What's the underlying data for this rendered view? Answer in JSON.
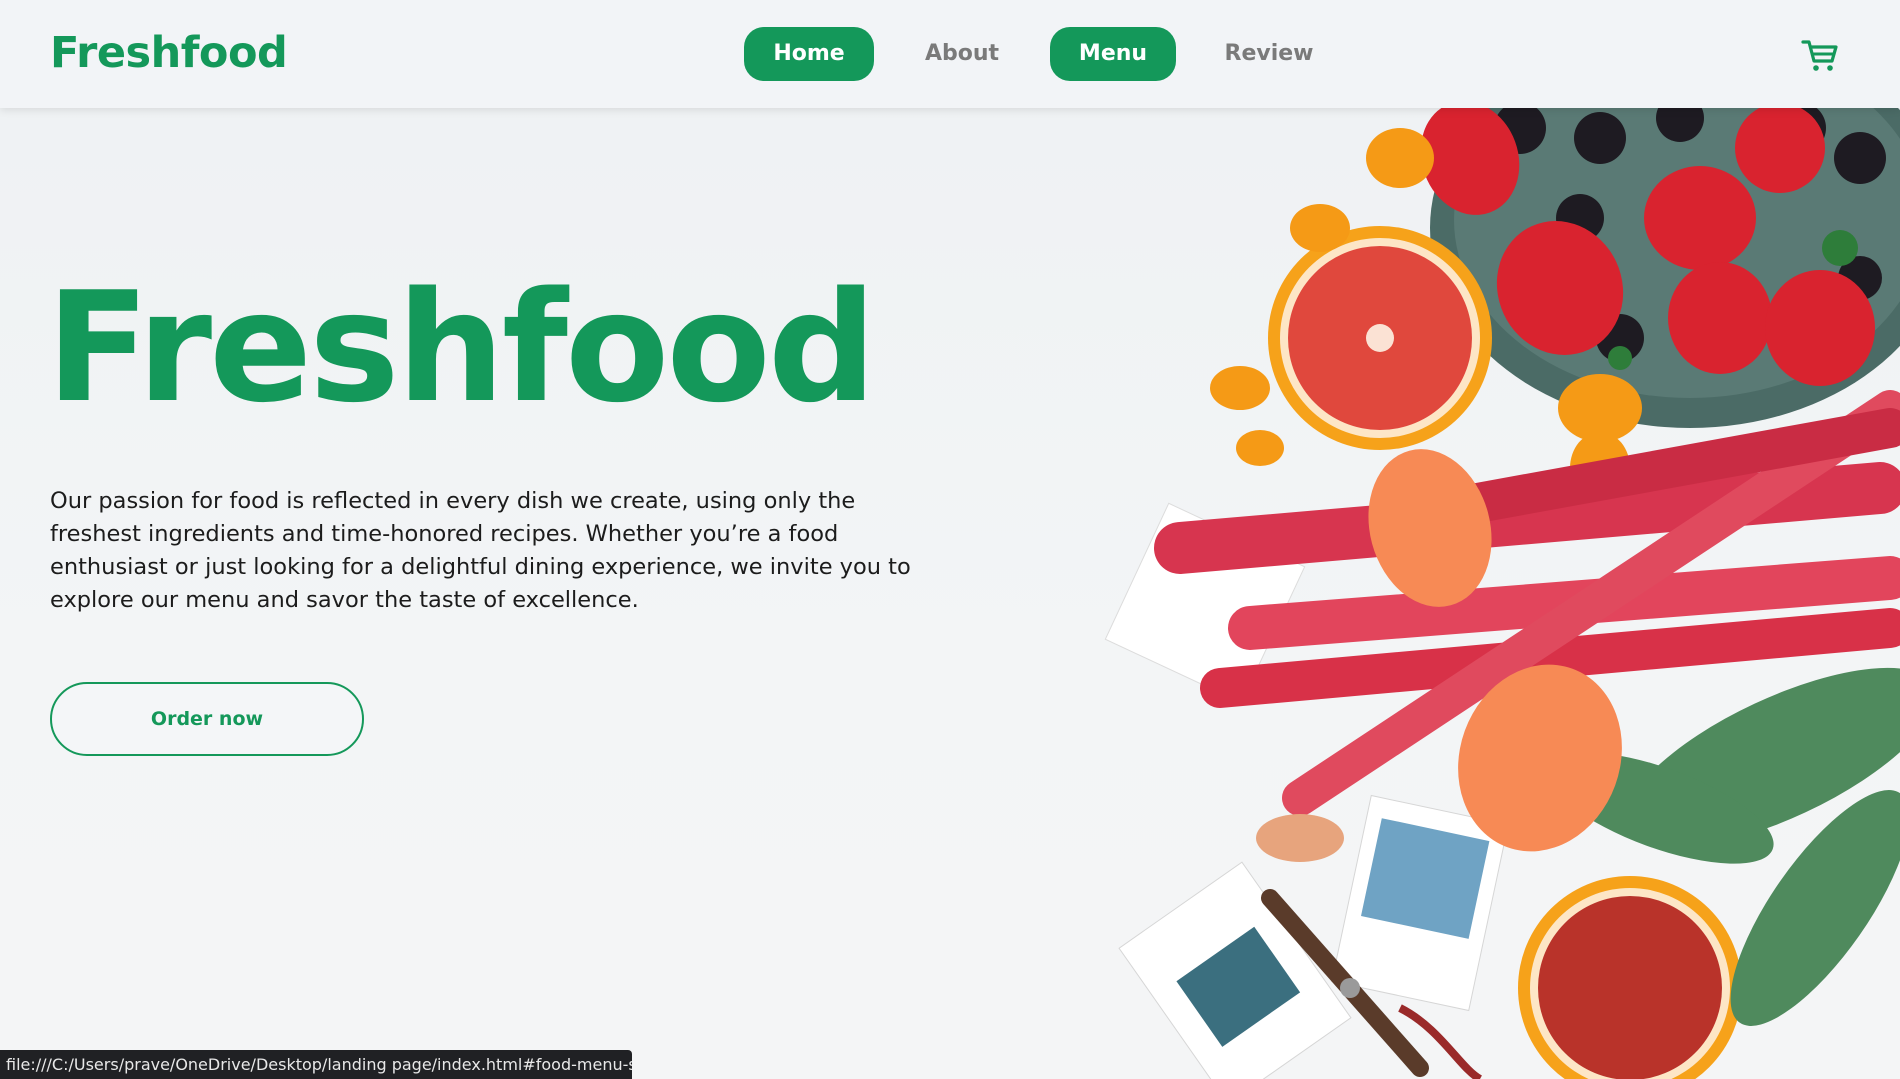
{
  "navbar": {
    "logo": "Freshfood",
    "links": [
      {
        "label": "Home",
        "active": true
      },
      {
        "label": "About",
        "active": false
      },
      {
        "label": "Menu",
        "active": true
      },
      {
        "label": "Review",
        "active": false
      }
    ],
    "cart_icon": "shopping-cart-icon"
  },
  "hero": {
    "title": "Freshfood",
    "description": "Our passion for food is reflected in every dish we create, using only the freshest ingredients and time-honored recipes. Whether you’re a food enthusiast or just looking for a delightful dining experience, we invite you to explore our menu and savor the taste of excellence.",
    "order_button": "Order now"
  },
  "status_bar": {
    "url": "file:///C:/Users/prave/OneDrive/Desktop/landing page/index.html#food-menu-section"
  },
  "colors": {
    "brand_green": "#14985a",
    "nav_inactive": "#7a7a7a",
    "background": "#f2f4f5"
  }
}
